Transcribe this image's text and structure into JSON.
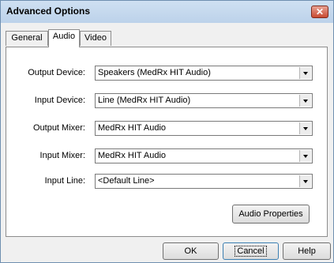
{
  "window": {
    "title": "Advanced Options"
  },
  "tabs": [
    {
      "label": "General"
    },
    {
      "label": "Audio"
    },
    {
      "label": "Video"
    }
  ],
  "audio": {
    "rows": [
      {
        "label": "Output Device:",
        "value": "Speakers (MedRx HIT Audio)"
      },
      {
        "label": "Input Device:",
        "value": "Line  (MedRx HIT Audio)"
      },
      {
        "label": "Output Mixer:",
        "value": "MedRx HIT Audio"
      },
      {
        "label": "Input Mixer:",
        "value": "MedRx HIT Audio"
      },
      {
        "label": "Input Line:",
        "value": "<Default Line>"
      }
    ],
    "properties_button": "Audio Properties"
  },
  "buttons": {
    "ok": "OK",
    "cancel": "Cancel",
    "help": "Help"
  },
  "icons": {
    "close": "close-icon",
    "dropdown": "chevron-down-icon"
  },
  "colors": {
    "titlebar": "#bcd2ea",
    "close": "#c94a31"
  }
}
